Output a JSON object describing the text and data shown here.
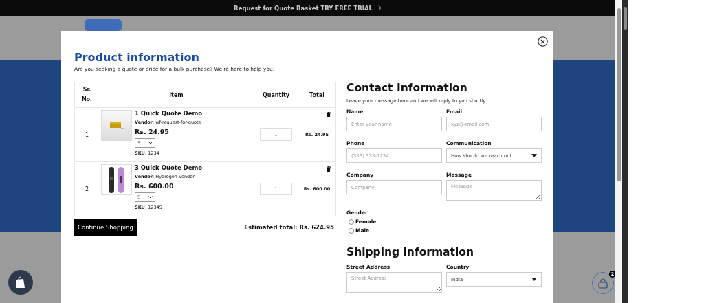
{
  "announcement": {
    "text": "Request for Quote Basket TRY FREE TRIAL"
  },
  "modal": {
    "title": "Product information",
    "subtitle": "Are you seeking a quote or price for a bulk purchase? We're here to help you.",
    "table": {
      "columns": [
        "Sr. No.",
        "item",
        "Quantity",
        "Total"
      ],
      "rows": [
        {
          "sr": "1",
          "name": "1 Quick Quote Demo",
          "vendor": "**Vendor**: wf-request-for-quote",
          "price": "Rs. 24.95",
          "variant": "S",
          "sku": "**SKU**: 1234",
          "quantity": "1",
          "total": "Rs. 24.95"
        },
        {
          "sr": "2",
          "name": "3 Quick Quote Demo",
          "vendor": "**Vendor**: Hydrogen Vendor",
          "price": "Rs. 600.00",
          "variant": "S",
          "sku": "**SKU**: 12345",
          "quantity": "1",
          "total": "Rs. 600.00"
        }
      ]
    },
    "continue_button": "Continue Shopping",
    "estimated_total": "Estimated total: Rs. 624.95",
    "contact": {
      "title": "Contact Information",
      "subtitle": "Leave your message here and we will reply to you shortly.",
      "fields": [
        {
          "kind": "text",
          "label": "Name",
          "placeholder": "Enter your name"
        },
        {
          "kind": "text",
          "label": "Email",
          "placeholder": "xyz@email.com"
        },
        {
          "kind": "text",
          "label": "Phone",
          "placeholder": "(333) 333-1234"
        },
        {
          "kind": "select",
          "label": "Communication",
          "value": "How should we reach out"
        },
        {
          "kind": "text",
          "label": "Company",
          "placeholder": "Company"
        },
        {
          "kind": "textarea",
          "label": "Message",
          "placeholder": "Message"
        }
      ],
      "gender": {
        "label": "Gender",
        "options": [
          {
            "label": "Female",
            "selected": false
          },
          {
            "label": "Male",
            "selected": false
          }
        ]
      }
    },
    "shipping": {
      "title": "Shipping information",
      "fields": [
        {
          "kind": "textarea",
          "label": "Street Address",
          "placeholder": "Street Address"
        },
        {
          "kind": "select",
          "label": "Country",
          "value": "India"
        }
      ]
    }
  },
  "cart": {
    "count": "2"
  }
}
